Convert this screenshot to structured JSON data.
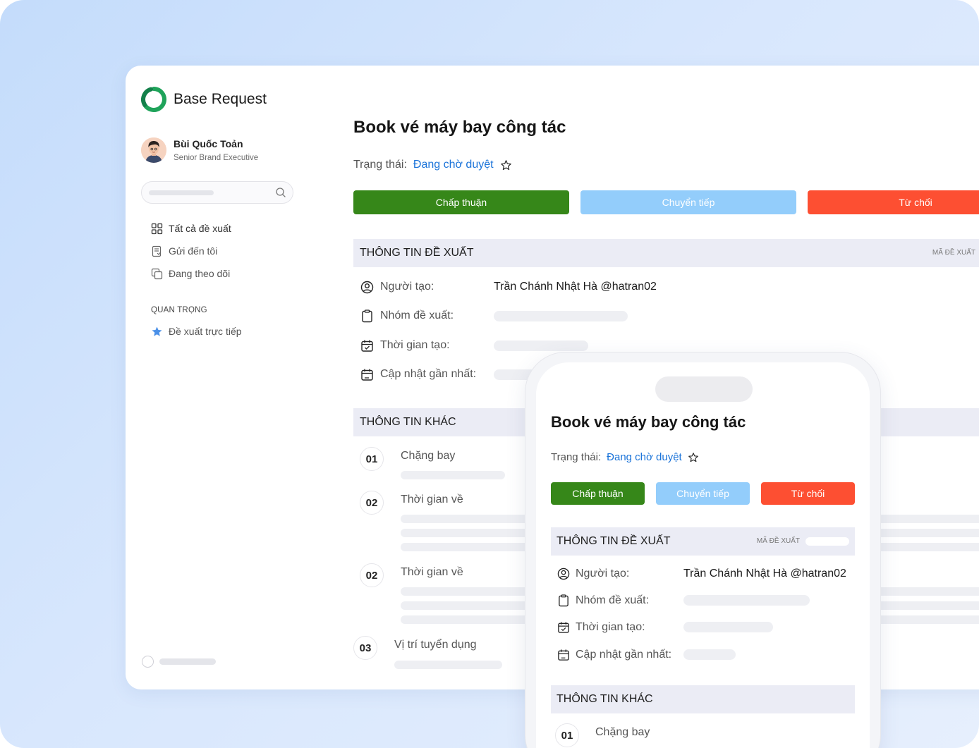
{
  "app": {
    "title": "Base Request"
  },
  "user": {
    "name": "Bùi Quốc Toản",
    "role": "Senior Brand Executive"
  },
  "sidebar": {
    "items": [
      {
        "label": "Tất cả đề xuất",
        "icon": "grid-icon"
      },
      {
        "label": "Gửi đến tôi",
        "icon": "inbox-doc-icon"
      },
      {
        "label": "Đang theo dõi",
        "icon": "copy-icon"
      }
    ],
    "section_label": "QUAN TRỌNG",
    "starred": {
      "label": "Đề xuất trực tiếp",
      "icon": "star-icon"
    }
  },
  "request": {
    "title": "Book vé máy bay công tác",
    "status_label": "Trạng thái:",
    "status_value": "Đang chờ duyệt",
    "buttons": {
      "approve": "Chấp thuận",
      "forward": "Chuyển tiếp",
      "reject": "Từ chối"
    },
    "info_section": {
      "title": "THÔNG TIN ĐỀ XUẤT",
      "code_label": "MÃ ĐỀ XUẤT",
      "rows": [
        {
          "label": "Người tạo:",
          "value": "Trần Chánh Nhật Hà @hatran02",
          "icon": "user-circle-icon"
        },
        {
          "label": "Nhóm đề xuất:",
          "value": "",
          "icon": "clipboard-icon"
        },
        {
          "label": "Thời gian tạo:",
          "value": "",
          "icon": "calendar-check-icon"
        },
        {
          "label": "Cập nhật gần nhất:",
          "value": "",
          "icon": "calendar-edit-icon"
        }
      ]
    },
    "other_section": {
      "title": "THÔNG TIN KHÁC",
      "steps": [
        {
          "num": "01",
          "label": "Chặng bay"
        },
        {
          "num": "02",
          "label": "Thời gian về"
        },
        {
          "num": "02",
          "label": "Thời gian về"
        },
        {
          "num": "03",
          "label": "Vị trí tuyển dụng"
        }
      ]
    }
  },
  "colors": {
    "approve": "#368719",
    "forward": "#93cdfb",
    "reject": "#fd4f32",
    "status_link": "#1a73d9",
    "section_bg": "#ebecf5",
    "brand_green": "#1fa35a"
  }
}
